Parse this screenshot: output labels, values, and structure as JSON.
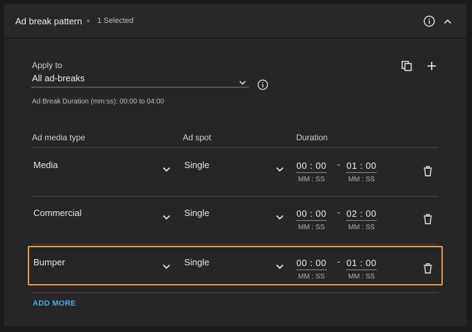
{
  "header": {
    "title": "Ad break pattern",
    "selected_count": "1 Selected",
    "info_icon": "info-icon",
    "collapse_icon": "chevron-up-icon"
  },
  "apply": {
    "label": "Apply to",
    "value": "All ad-breaks",
    "range_text": "Ad Break Duration (mm:ss): 00:00 to 04:00"
  },
  "columns": {
    "media_type": "Ad media type",
    "ad_spot": "Ad spot",
    "duration": "Duration"
  },
  "rows": [
    {
      "media_type": "Media",
      "ad_spot": "Single",
      "start": "00 : 00",
      "end": "01 : 00",
      "unit": "MM : SS",
      "dash": "-",
      "highlighted": false
    },
    {
      "media_type": "Commercial",
      "ad_spot": "Single",
      "start": "00 : 00",
      "end": "02 : 00",
      "unit": "MM : SS",
      "dash": "-",
      "highlighted": false
    },
    {
      "media_type": "Bumper",
      "ad_spot": "Single",
      "start": "00 : 00",
      "end": "01 : 00",
      "unit": "MM : SS",
      "dash": "-",
      "highlighted": true
    }
  ],
  "add_more": "ADD MORE",
  "colors": {
    "highlight": "#e49a50",
    "link": "#4aa8e0",
    "panel": "#282828"
  }
}
